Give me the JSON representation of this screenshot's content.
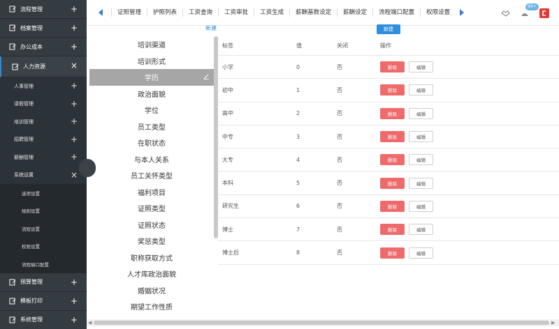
{
  "sidebar": {
    "top": [
      {
        "label": "流程管理",
        "toggle": "+"
      },
      {
        "label": "档案管理",
        "toggle": "+"
      },
      {
        "label": "办公成本",
        "toggle": "+"
      }
    ],
    "active": {
      "label": "人力资源",
      "toggle": "×"
    },
    "subs": [
      {
        "label": "人事管理",
        "toggle": "+"
      },
      {
        "label": "请假管理",
        "toggle": "+"
      },
      {
        "label": "培训管理",
        "toggle": "+"
      },
      {
        "label": "招聘管理",
        "toggle": "+"
      },
      {
        "label": "薪酬管理",
        "toggle": "+"
      },
      {
        "label": "系统设置",
        "toggle": "×"
      }
    ],
    "leaves": [
      "选项设置",
      "规则设置",
      "流程设置",
      "权限设置",
      "流程端口配置"
    ],
    "bottom": [
      {
        "label": "预算管理",
        "toggle": "+"
      },
      {
        "label": "模板打印",
        "toggle": "+"
      },
      {
        "label": "系统管理",
        "toggle": "+"
      }
    ]
  },
  "tabs": [
    "证照管理",
    "护照列表",
    "工资查询",
    "工资审批",
    "工资生成",
    "薪酬基数设定",
    "薪酬设定",
    "流程端口配置",
    "权限设置"
  ],
  "notifications": {
    "badge": "99+"
  },
  "list": {
    "new_label": "新建",
    "items": [
      "培训渠道",
      "培训形式",
      "学历",
      "政治面貌",
      "学位",
      "员工类型",
      "在职状态",
      "与本人关系",
      "员工关怀类型",
      "福利项目",
      "证照类型",
      "证照状态",
      "奖惩类型",
      "职称获取方式",
      "人才库政治面貌",
      "婚姻状况",
      "期望工作性质"
    ],
    "selected_index": 2
  },
  "table": {
    "new_button": "新建",
    "headers": {
      "label": "标签",
      "value": "值",
      "closed": "关闭",
      "action": "操作"
    },
    "delete_label": "删除",
    "edit_label": "编辑",
    "rows": [
      {
        "label": "小学",
        "value": "0",
        "closed": "否"
      },
      {
        "label": "初中",
        "value": "1",
        "closed": "否"
      },
      {
        "label": "高中",
        "value": "2",
        "closed": "否"
      },
      {
        "label": "中专",
        "value": "3",
        "closed": "否"
      },
      {
        "label": "大专",
        "value": "4",
        "closed": "否"
      },
      {
        "label": "本科",
        "value": "5",
        "closed": "否"
      },
      {
        "label": "研究生",
        "value": "6",
        "closed": "否"
      },
      {
        "label": "博士",
        "value": "7",
        "closed": "否"
      },
      {
        "label": "博士后",
        "value": "8",
        "closed": "否"
      }
    ]
  },
  "colors": {
    "sidebar_bg": "#2b3238",
    "accent": "#2f8fde",
    "delete": "#ef6b6b",
    "selected_item": "#a6a6a6"
  }
}
